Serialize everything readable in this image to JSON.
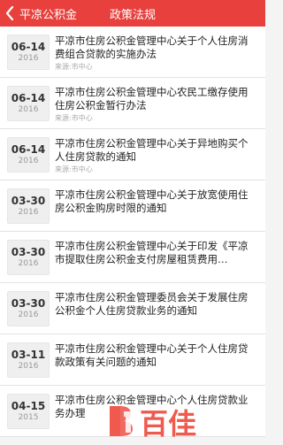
{
  "nav": {
    "back_label": "平凉公积金",
    "title": "政策法规"
  },
  "items": [
    {
      "month_day": "06-14",
      "year": "2016",
      "title": "平凉市住房公积金管理中心关于个人住房消费组合贷款的实施办法",
      "source": "来源:市中心"
    },
    {
      "month_day": "06-14",
      "year": "2016",
      "title": "平凉市住房公积金管理中心农民工缴存使用住房公积金暂行办法",
      "source": "来源:市中心"
    },
    {
      "month_day": "06-14",
      "year": "2016",
      "title": "平凉市住房公积金管理中心关于异地购买个人住房贷款的通知",
      "source": "来源:市中心"
    },
    {
      "month_day": "03-30",
      "year": "2016",
      "title": "平凉市住房公积金管理中心关于放宽使用住房公积金购房时限的通知",
      "source": ""
    },
    {
      "month_day": "03-30",
      "year": "2016",
      "title": "平凉市住房公积金管理中心关于印发《平凉市提取住房公积金支付房屋租赁费用…",
      "source": ""
    },
    {
      "month_day": "03-30",
      "year": "2016",
      "title": "平凉市住房公积金管理委员会关于发展住房公积金个人住房贷款业务的通知",
      "source": ""
    },
    {
      "month_day": "03-11",
      "year": "2016",
      "title": "平凉市住房公积金管理中心关于个人住房贷款政策有关问题的通知",
      "source": ""
    },
    {
      "month_day": "04-15",
      "year": "2015",
      "title": "平凉市住房公积金管理中心个人住房贷款业务办理",
      "source": ""
    }
  ],
  "watermark": {
    "text": "百佳",
    "color": "#f05a4e"
  }
}
